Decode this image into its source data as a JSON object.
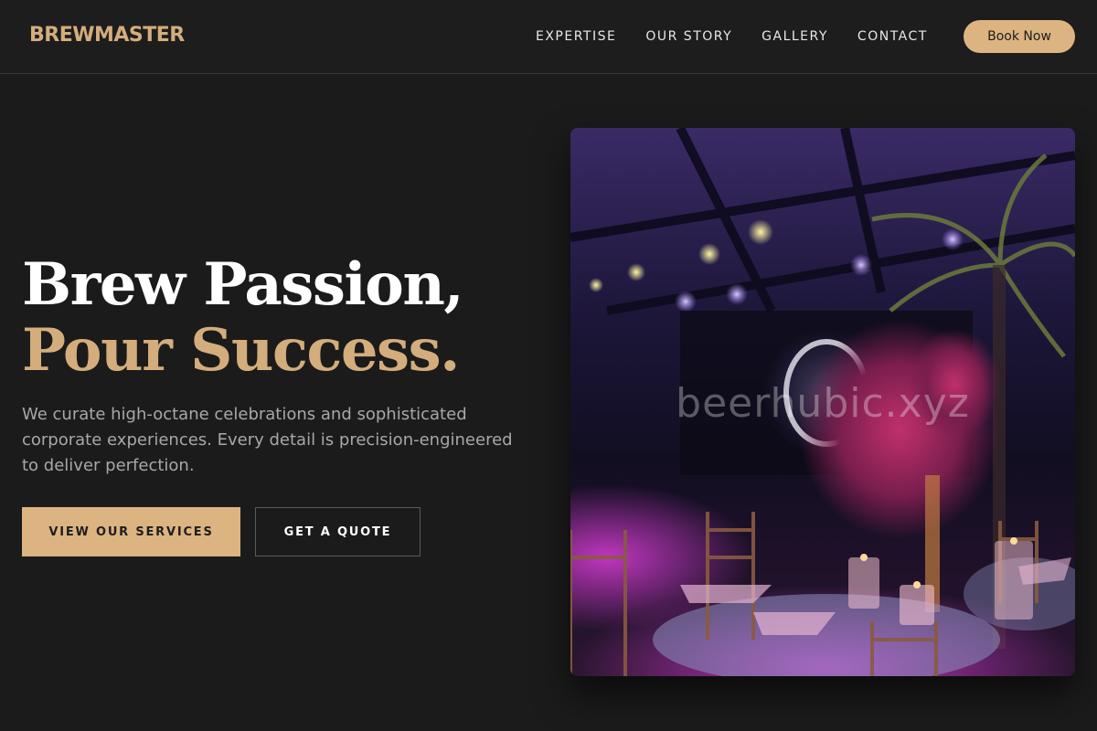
{
  "brand": {
    "logo_text": "BREWMASTER"
  },
  "nav": {
    "items": [
      {
        "label": "EXPERTISE"
      },
      {
        "label": "OUR STORY"
      },
      {
        "label": "GALLERY"
      },
      {
        "label": "CONTACT"
      }
    ],
    "cta_label": "Book Now"
  },
  "hero": {
    "title_line1": "Brew Passion,",
    "title_line2": "Pour Success.",
    "description": "We curate high-octane celebrations and sophisticated corporate experiences. Every detail is precision-engineered to deliver perfection.",
    "primary_button": "VIEW OUR SERVICES",
    "secondary_button": "GET A QUOTE"
  },
  "image": {
    "subject": "event-venue-photo",
    "watermark": "beerhubic.xyz"
  },
  "colors": {
    "background": "#1b1b1b",
    "accent": "#dcb481",
    "accent_text": "#d4ad7c",
    "body_text": "#a8a8a8"
  }
}
